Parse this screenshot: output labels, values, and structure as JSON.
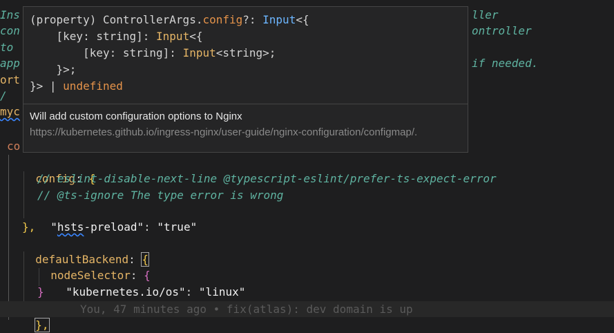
{
  "background_lines": {
    "l1_left": "Ins",
    "l1_right": "ller",
    "l2_left": "con",
    "l2_right": "ontroller",
    "l3_left": "to",
    "l4_left": "app",
    "l4_right": "if needed.",
    "l5_left": "ort",
    "l6_left": "/",
    "l7_left": "myc",
    "l8_left": "co"
  },
  "editor": {
    "config_key": "config",
    "comment1": "// eslint-disable-next-line @typescript-eslint/prefer-ts-expect-error",
    "comment2": "// @ts-ignore The type error is wrong",
    "hsts_key_prefix": "\"",
    "hsts_key_squig": "hsts",
    "hsts_key_rest": "-preload\"",
    "hsts_value": "\"true\"",
    "close1": "},",
    "default_backend_key": "defaultBackend",
    "node_selector_key": "nodeSelector",
    "os_key": "\"kubernetes.io/os\"",
    "os_value": "\"linux\"",
    "close_inner": "}",
    "close_last": "},",
    "blame": "You, 47 minutes ago • fix(atlas): dev domain is up"
  },
  "hover": {
    "sig_l1_a": "(property) ControllerArgs.",
    "sig_l1_prop": "config",
    "sig_l1_b": "?: ",
    "sig_l1_type": "Input",
    "sig_l1_c": "<{",
    "sig_l2_a": "    [key: ",
    "sig_l2_kw": "string",
    "sig_l2_b": "]: ",
    "sig_l2_type": "Input",
    "sig_l2_c": "<{",
    "sig_l3_a": "        [key: ",
    "sig_l3_kw": "string",
    "sig_l3_b": "]: ",
    "sig_l3_type": "Input",
    "sig_l3_c": "<string>;",
    "sig_l4": "    }>;",
    "sig_l5_a": "}> | ",
    "sig_l5_undef": "undefined",
    "doc_main": "Will add custom configuration options to Nginx",
    "doc_link": "https://kubernetes.github.io/ingress-nginx/user-guide/nginx-configuration/configmap/."
  }
}
